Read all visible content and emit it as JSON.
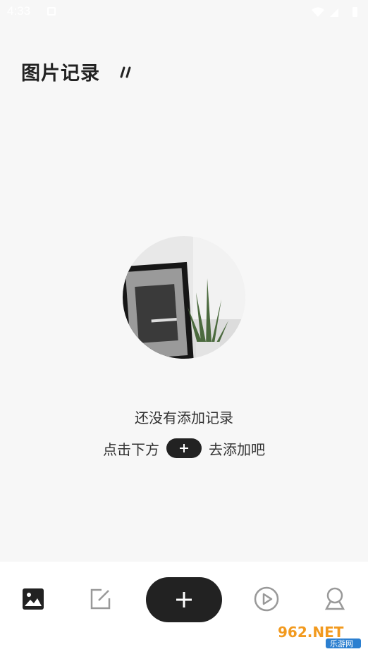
{
  "status_bar": {
    "time": "4:33",
    "icons": [
      "notification-icon",
      "wifi-icon",
      "signal-icon",
      "battery-icon"
    ]
  },
  "header": {
    "title": "图片记录",
    "title_mark_icon": "double-slash-icon"
  },
  "empty_state": {
    "illustration": "framed-picture-and-plant-photo",
    "line1": "还没有添加记录",
    "line2_before": "点击下方",
    "line2_after": "去添加吧",
    "inline_icon": "plus-icon"
  },
  "bottom_nav": {
    "items": [
      {
        "id": "photos",
        "icon": "image-icon",
        "active": true
      },
      {
        "id": "notes",
        "icon": "edit-icon",
        "active": false
      },
      {
        "id": "add",
        "icon": "plus-icon",
        "active": false
      },
      {
        "id": "video",
        "icon": "play-icon",
        "active": false
      },
      {
        "id": "profile",
        "icon": "user-icon",
        "active": false
      }
    ]
  },
  "watermark": {
    "text_top": "962.NET",
    "text_bottom": "乐游网"
  },
  "colors": {
    "background": "#f7f7f7",
    "nav_background": "#ffffff",
    "primary_dark": "#222222",
    "inactive_icon": "#999999",
    "watermark_orange": "#f29a1f"
  }
}
